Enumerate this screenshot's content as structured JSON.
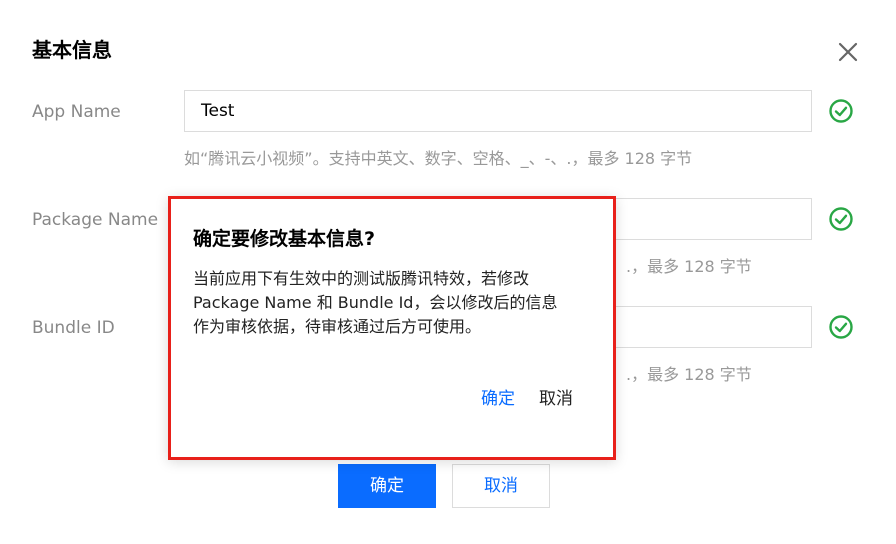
{
  "dialog": {
    "title": "基本信息",
    "close_icon": "close-icon"
  },
  "fields": [
    {
      "label": "App Name",
      "value": "Test",
      "hint": "如“腾讯云小视频”。支持中英文、数字、空格、_、-、.，最多 128 字节",
      "status_icon": "check-circle-icon"
    },
    {
      "label": "Package Name",
      "value": "",
      "hint_tail": ".，最多 128 字节",
      "status_icon": "check-circle-icon"
    },
    {
      "label": "Bundle ID",
      "value": "",
      "hint_tail": ".，最多 128 字节",
      "status_icon": "check-circle-icon"
    }
  ],
  "footer": {
    "confirm_label": "确定",
    "cancel_label": "取消"
  },
  "confirm_popover": {
    "title": "确定要修改基本信息?",
    "body_lines": [
      "当前应用下有生效中的测试版腾讯特效，若修改",
      "Package Name 和 Bundle Id，会以修改后的信息",
      "作为审核依据，待审核通过后方可使用。"
    ],
    "ok_label": "确定",
    "cancel_label": "取消"
  },
  "colors": {
    "primary": "#0a6cff",
    "success": "#29a745",
    "highlight_border": "#e8201a"
  }
}
